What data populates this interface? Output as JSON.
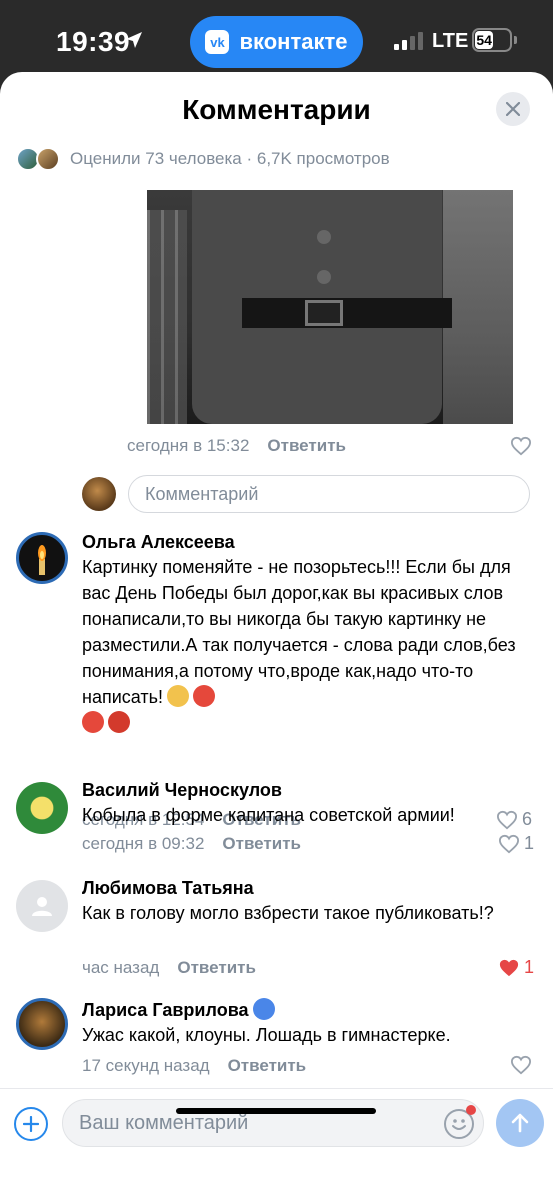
{
  "status_bar": {
    "time": "19:39",
    "app_pill": "вконтакте",
    "app_pill_logo": "vk",
    "network": "LTE",
    "battery": "54"
  },
  "sheet": {
    "title": "Комментарии",
    "meta": "Оценили 73 человека · 6,7K просмотров"
  },
  "top_comment": {
    "time": "сегодня в 15:32",
    "reply_label": "Ответить"
  },
  "reply_box": {
    "placeholder": "Комментарий"
  },
  "comments": [
    {
      "author": "Ольга Алексеева",
      "text": "Картинку поменяйте - не позорьтесь!!! Если бы для вас День Победы был дорог,как вы красивых слов понаписали,то вы никогда бы такую картинку не разместили.А так получается - слова ради слов,без понимания,а потому что,вроде как,надо что-то написать!",
      "time": "сегодня в 12:54",
      "reply_label": "Ответить",
      "likes": "6",
      "liked": false
    },
    {
      "author": "Василий Черноскулов",
      "text": "Кобыла в форме капитана советской армии!",
      "time": "сегодня в 09:32",
      "reply_label": "Ответить",
      "likes": "1",
      "liked": false
    },
    {
      "author": "Любимова Татьяна",
      "text": "Как в голову могло взбрести такое публиковать!?",
      "time": "час назад",
      "reply_label": "Ответить",
      "likes": "1",
      "liked": true
    },
    {
      "author": "Лариса Гаврилова",
      "text": "Ужас какой, клоуны. Лошадь в гимнастерке.",
      "time": "17 секунд назад",
      "reply_label": "Ответить",
      "likes": "",
      "liked": false
    }
  ],
  "composer": {
    "placeholder": "Ваш комментарий"
  },
  "colors": {
    "accent": "#2688eb",
    "secondary_text": "#818c99",
    "liked": "#e64646"
  }
}
